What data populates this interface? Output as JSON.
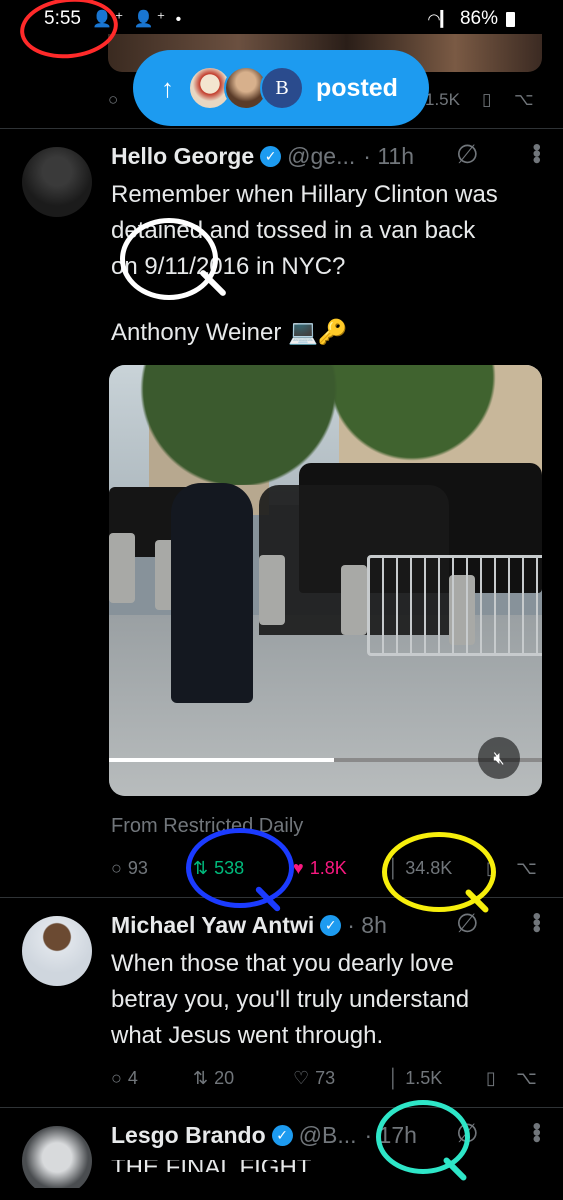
{
  "status_bar": {
    "time": "5:55",
    "left_icons": "👤⁺ 👤⁺ •",
    "battery": "86%"
  },
  "pill": {
    "arrow": "↑",
    "label": "posted",
    "avatar3_letter": "B"
  },
  "prev_row": {
    "views": "1.5K"
  },
  "tweets": [
    {
      "name": "Hello George",
      "handle": "@ge...",
      "time": "· 11h",
      "lines": [
        "Remember when Hillary Clinton was",
        "detained and tossed in a van back",
        "on 9/11/2016 in NYC?",
        "",
        "Anthony Weiner 💻🔑"
      ],
      "source": "From Restricted Daily",
      "video_progress": 0.52,
      "replies": "93",
      "reposts": "538",
      "likes": "1.8K",
      "views": "34.8K"
    },
    {
      "name": "Michael Yaw Antwi",
      "handle": "",
      "time": "· 8h",
      "lines": [
        "When those that you dearly love",
        "betray you, you'll truly understand",
        "what Jesus went through."
      ],
      "replies": "4",
      "reposts": "20",
      "likes": "73",
      "views": "1.5K"
    },
    {
      "name": "Lesgo Brando",
      "handle": "@B...",
      "time": "· 17h",
      "lines": [
        "THE FINAL FIGHT"
      ]
    }
  ],
  "colors": {
    "accent": "#1d9bf0",
    "repost_active": "#00ba7c",
    "like_active": "#f91880",
    "annotation_red": "#ff2a2a",
    "annotation_blue": "#1b3bff",
    "annotation_yellow": "#f7ef0c",
    "annotation_cyan": "#2ee6c8"
  }
}
